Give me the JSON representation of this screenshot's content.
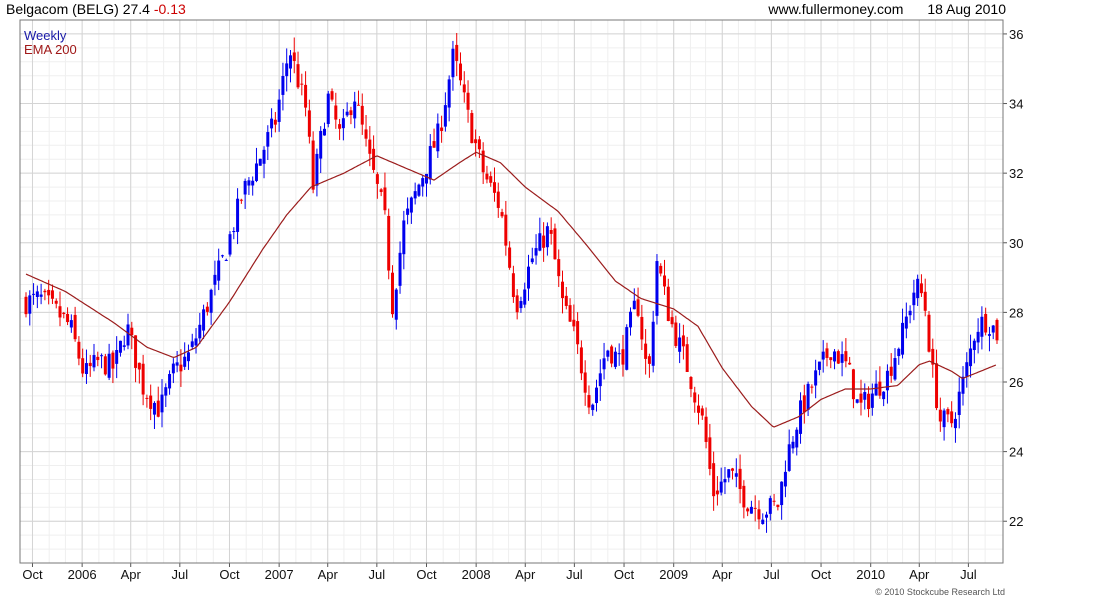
{
  "header": {
    "security": "Belgacom (BELG)",
    "price": "27.4",
    "change": "-0.13",
    "website": "www.fullermoney.com",
    "date": "18 Aug 2010"
  },
  "legend": {
    "series1": "Weekly",
    "series2": "EMA 200"
  },
  "footer": "© 2010 Stockcube Research Ltd",
  "colors": {
    "up": "#0000ee",
    "down": "#ee0000",
    "ema": "#9b1c1c",
    "grid": "#d4d4d4",
    "background": "#ffffff"
  },
  "chart_data": {
    "type": "candlestick",
    "title": "Belgacom (BELG)",
    "interval": "Weekly",
    "ylim": [
      20.8,
      36.4
    ],
    "y_ticks": [
      22,
      24,
      26,
      28,
      30,
      32,
      34,
      36
    ],
    "x_ticks": [
      "Oct",
      "2006",
      "Apr",
      "Jul",
      "Oct",
      "2007",
      "Apr",
      "Jul",
      "Oct",
      "2008",
      "Apr",
      "Jul",
      "Oct",
      "2009",
      "Apr",
      "Jul",
      "Oct",
      "2010",
      "Apr",
      "Jul"
    ],
    "x_range": [
      "2005-09-19",
      "2010-08-23"
    ],
    "tick_dates": [
      "2005-10-01",
      "2006-01-01",
      "2006-04-01",
      "2006-07-01",
      "2006-10-01",
      "2007-01-01",
      "2007-04-01",
      "2007-07-01",
      "2007-10-01",
      "2008-01-01",
      "2008-04-01",
      "2008-07-01",
      "2008-10-01",
      "2009-01-01",
      "2009-04-01",
      "2009-07-01",
      "2009-10-01",
      "2010-01-01",
      "2010-04-01",
      "2010-07-01"
    ],
    "close_anchors": [
      [
        "2005-09-19",
        28.3
      ],
      [
        "2005-10-15",
        28.4
      ],
      [
        "2005-11-15",
        28.0
      ],
      [
        "2005-12-10",
        27.6
      ],
      [
        "2006-01-05",
        26.2
      ],
      [
        "2006-02-01",
        26.6
      ],
      [
        "2006-03-01",
        26.4
      ],
      [
        "2006-03-25",
        27.6
      ],
      [
        "2006-04-25",
        25.8
      ],
      [
        "2006-05-25",
        25.2
      ],
      [
        "2006-06-20",
        26.3
      ],
      [
        "2006-07-20",
        26.8
      ],
      [
        "2006-08-25",
        28.4
      ],
      [
        "2006-09-25",
        29.8
      ],
      [
        "2006-10-25",
        31.4
      ],
      [
        "2006-11-25",
        32.4
      ],
      [
        "2006-12-25",
        33.5
      ],
      [
        "2007-01-20",
        35.6
      ],
      [
        "2007-02-20",
        33.8
      ],
      [
        "2007-03-05",
        31.6
      ],
      [
        "2007-04-01",
        34.2
      ],
      [
        "2007-04-25",
        33.0
      ],
      [
        "2007-05-20",
        34.3
      ],
      [
        "2007-06-15",
        32.5
      ],
      [
        "2007-07-15",
        30.8
      ],
      [
        "2007-07-30",
        28.2
      ],
      [
        "2007-08-20",
        30.5
      ],
      [
        "2007-09-20",
        31.8
      ],
      [
        "2007-10-25",
        33.2
      ],
      [
        "2007-11-20",
        35.4
      ],
      [
        "2007-12-20",
        33.4
      ],
      [
        "2008-01-15",
        32.0
      ],
      [
        "2008-02-15",
        31.0
      ],
      [
        "2008-03-15",
        28.2
      ],
      [
        "2008-04-15",
        29.6
      ],
      [
        "2008-05-15",
        30.4
      ],
      [
        "2008-06-10",
        28.2
      ],
      [
        "2008-07-01",
        27.3
      ],
      [
        "2008-08-01",
        25.3
      ],
      [
        "2008-08-30",
        27.0
      ],
      [
        "2008-09-25",
        26.6
      ],
      [
        "2008-10-25",
        28.4
      ],
      [
        "2008-11-15",
        26.0
      ],
      [
        "2008-12-01",
        29.5
      ],
      [
        "2008-12-25",
        27.8
      ],
      [
        "2009-01-25",
        26.5
      ],
      [
        "2009-02-25",
        24.8
      ],
      [
        "2009-03-15",
        22.8
      ],
      [
        "2009-04-15",
        23.4
      ],
      [
        "2009-05-15",
        22.6
      ],
      [
        "2009-06-15",
        22.3
      ],
      [
        "2009-07-15",
        22.5
      ],
      [
        "2009-07-25",
        23.6
      ],
      [
        "2009-08-20",
        25.0
      ],
      [
        "2009-09-20",
        26.1
      ],
      [
        "2009-10-20",
        27.0
      ],
      [
        "2009-11-20",
        26.4
      ],
      [
        "2009-12-10",
        25.2
      ],
      [
        "2010-01-01",
        25.6
      ],
      [
        "2010-02-01",
        26.2
      ],
      [
        "2010-03-01",
        27.4
      ],
      [
        "2010-03-25",
        28.8
      ],
      [
        "2010-04-10",
        28.4
      ],
      [
        "2010-04-25",
        26.3
      ],
      [
        "2010-05-10",
        24.9
      ],
      [
        "2010-05-30",
        24.8
      ],
      [
        "2010-06-25",
        26.2
      ],
      [
        "2010-07-15",
        27.6
      ],
      [
        "2010-08-05",
        27.8
      ],
      [
        "2010-08-23",
        27.4
      ]
    ],
    "ema_anchors": [
      [
        "2005-09-19",
        29.1
      ],
      [
        "2005-12-01",
        28.6
      ],
      [
        "2006-03-01",
        27.7
      ],
      [
        "2006-05-01",
        27.0
      ],
      [
        "2006-06-20",
        26.7
      ],
      [
        "2006-08-01",
        27.0
      ],
      [
        "2006-10-01",
        28.3
      ],
      [
        "2006-12-01",
        29.8
      ],
      [
        "2007-01-15",
        30.8
      ],
      [
        "2007-03-01",
        31.6
      ],
      [
        "2007-05-01",
        32.0
      ],
      [
        "2007-07-01",
        32.5
      ],
      [
        "2007-08-15",
        32.2
      ],
      [
        "2007-10-15",
        31.8
      ],
      [
        "2007-12-01",
        32.3
      ],
      [
        "2008-01-01",
        32.6
      ],
      [
        "2008-02-15",
        32.3
      ],
      [
        "2008-04-01",
        31.6
      ],
      [
        "2008-06-01",
        30.9
      ],
      [
        "2008-07-20",
        30.0
      ],
      [
        "2008-09-15",
        28.9
      ],
      [
        "2008-11-01",
        28.4
      ],
      [
        "2009-01-01",
        28.1
      ],
      [
        "2009-02-15",
        27.6
      ],
      [
        "2009-04-01",
        26.4
      ],
      [
        "2009-05-25",
        25.3
      ],
      [
        "2009-07-05",
        24.7
      ],
      [
        "2009-08-20",
        25.0
      ],
      [
        "2009-10-01",
        25.5
      ],
      [
        "2009-11-15",
        25.8
      ],
      [
        "2010-01-01",
        25.8
      ],
      [
        "2010-02-20",
        25.9
      ],
      [
        "2010-04-01",
        26.5
      ],
      [
        "2010-04-20",
        26.6
      ],
      [
        "2010-06-01",
        26.3
      ],
      [
        "2010-06-20",
        26.1
      ],
      [
        "2010-08-23",
        26.5
      ]
    ]
  }
}
